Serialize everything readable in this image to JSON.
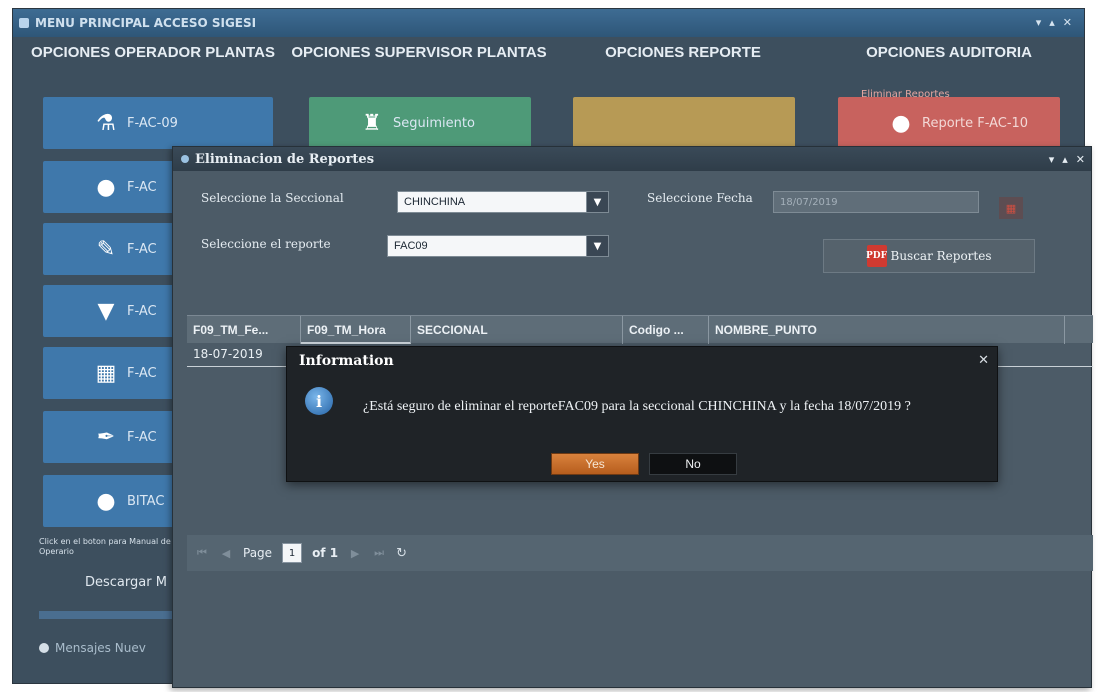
{
  "main": {
    "title": "MENU PRINCIPAL ACCESO SIGESI",
    "columns": [
      "OPCIONES OPERADOR PLANTAS",
      "OPCIONES SUPERVISOR PLANTAS",
      "OPCIONES REPORTE",
      "OPCIONES AUDITORIA"
    ],
    "audit_link": "Eliminar Reportes",
    "operator_tiles": [
      "F-AC-09",
      "F-AC",
      "F-AC",
      "F-AC",
      "F-AC",
      "F-AC",
      "BITAC"
    ],
    "supervisor_tile": "Seguimiento",
    "report_tile_red": "Reporte F-AC-10",
    "footer_text": "Click en el boton para Manual de Operario",
    "download_label": "Descargar M",
    "messages_label": "Mensajes Nuev"
  },
  "elim": {
    "title": "Eliminacion de Reportes",
    "seccional_label": "Seleccione la Seccional",
    "seccional_value": "CHINCHINA",
    "fecha_label": "Seleccione Fecha",
    "fecha_value": "18/07/2019",
    "reporte_label": "Seleccione el reporte",
    "reporte_value": "FAC09",
    "search_button": "Buscar Reportes",
    "grid_headers": [
      "F09_TM_Fe...",
      "F09_TM_Hora",
      "SECCIONAL",
      "Codigo ...",
      "NOMBRE_PUNTO"
    ],
    "grid_rows": [
      [
        "18-07-2019"
      ]
    ],
    "pager": {
      "page_label": "Page",
      "page_value": "1",
      "of_label": "of 1"
    }
  },
  "dialog": {
    "title": "Information",
    "message": "¿Está seguro de eliminar el reporteFAC09 para la seccional CHINCHINA y la fecha 18/07/2019 ?",
    "yes": "Yes",
    "no": "No"
  },
  "colors": {
    "yes_button": "#c66f2b",
    "operator_tile": "#3f78ab",
    "supervisor_tile": "#4e9a78",
    "report_tile": "#b79a55",
    "audit_tile": "#c8625e"
  }
}
